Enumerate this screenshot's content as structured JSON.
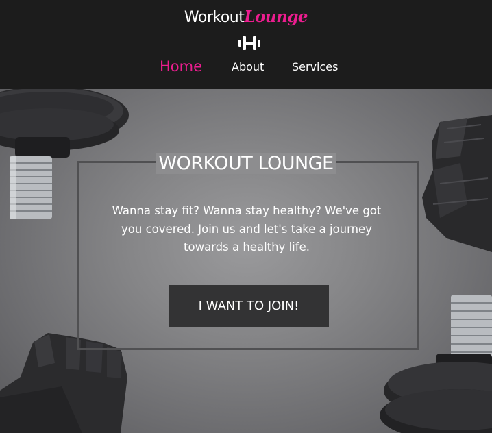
{
  "header": {
    "brand_main": "Workout",
    "brand_accent": "Lounge",
    "logo_icon": "dumbbell-icon",
    "colors": {
      "background": "#1c1c1c",
      "accent": "#ec1d8f",
      "text": "#ffffff"
    }
  },
  "nav": {
    "items": [
      {
        "label": "Home",
        "active": true
      },
      {
        "label": "About",
        "active": false
      },
      {
        "label": "Services",
        "active": false
      }
    ]
  },
  "hero": {
    "title": "WORKOUT LOUNGE",
    "text": "Wanna stay fit? Wanna stay healthy? We've got you covered. Join us and let's take a journey towards a healthy life.",
    "cta_label": "I WANT TO JOIN!",
    "decor": [
      "dumbbell-plate-top-left",
      "glove-top-right",
      "glove-bottom-left",
      "dumbbell-plate-bottom-right"
    ]
  }
}
